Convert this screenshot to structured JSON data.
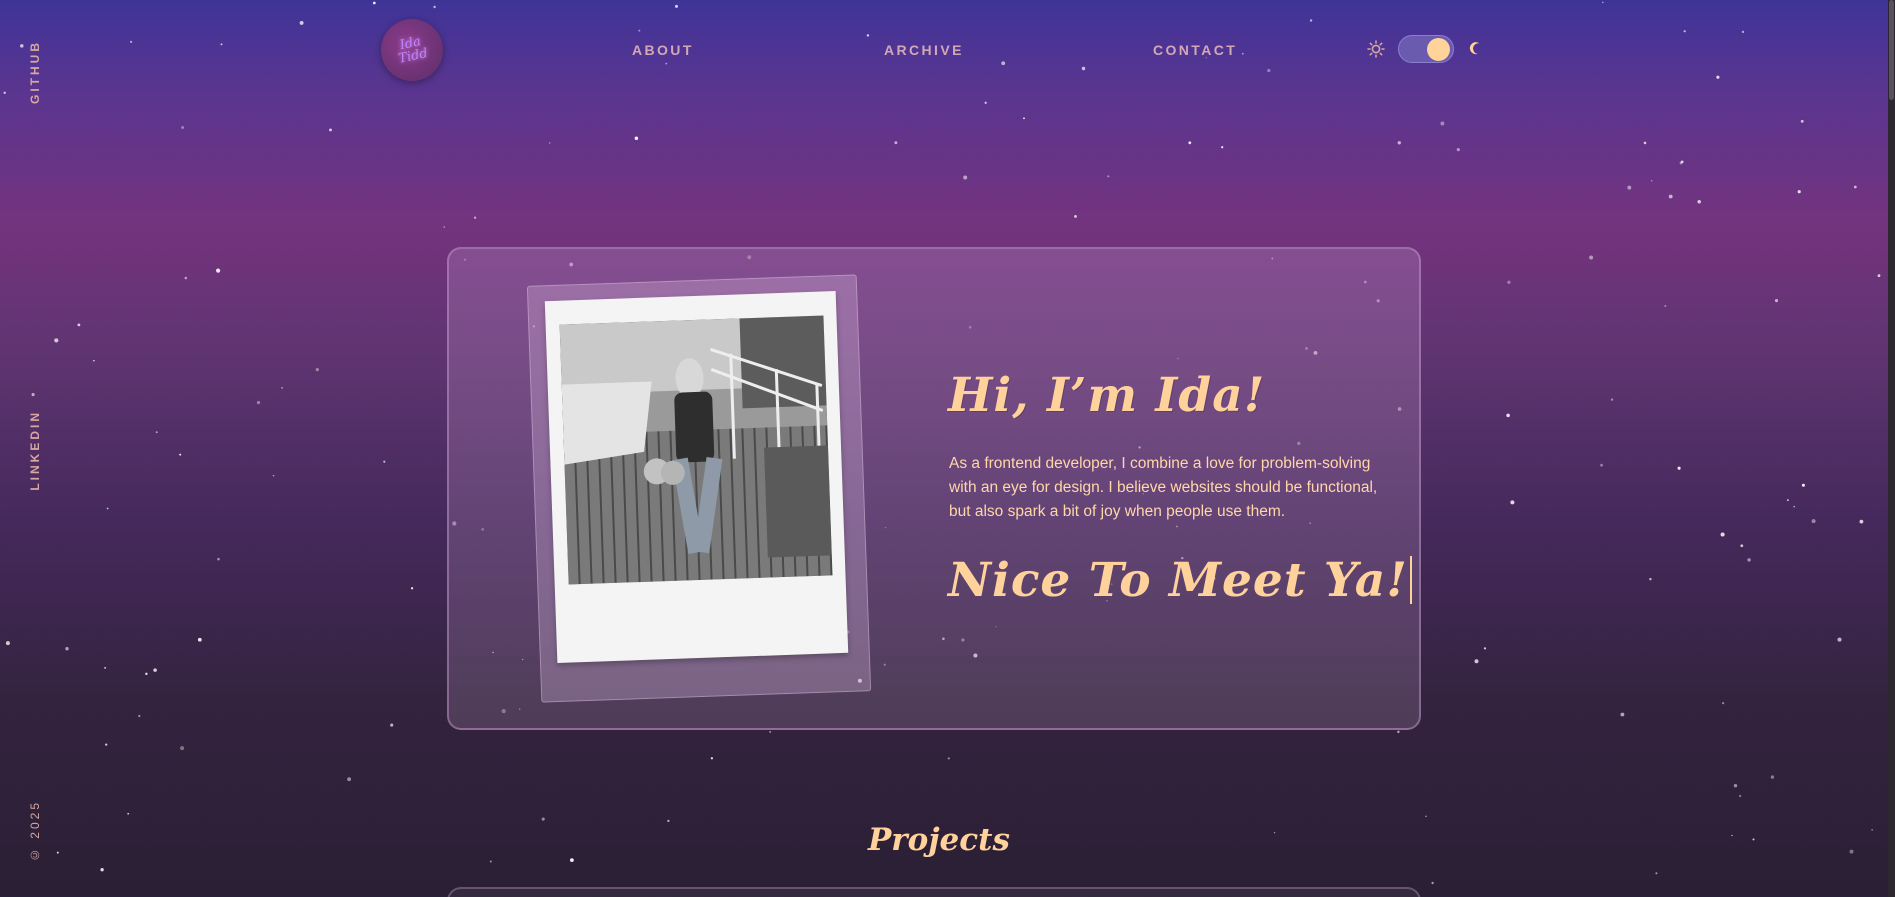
{
  "side_links": {
    "github": "GITHUB",
    "linkedin": "LINKEDIN",
    "copyright": "© 2025"
  },
  "header": {
    "logo_text_line1": "Ida",
    "logo_text_line2": "Tidd",
    "nav": {
      "about": "ABOUT",
      "archive": "ARCHIVE",
      "contact": "CONTACT"
    },
    "theme_toggle": {
      "sun_icon": "sun-icon",
      "moon_icon": "moon-icon",
      "mode": "dark"
    }
  },
  "hero": {
    "title": "Hi, I’m Ida!",
    "bio": "As a frontend developer, I combine a love for problem-solving with an eye for design. I believe websites should be functional, but also spark a bit of joy when people use them.",
    "tagline": "Nice To Meet Ya!"
  },
  "sections": {
    "projects_title": "Projects"
  },
  "colors": {
    "accent": "#ffd29c",
    "text": "#ffd7a8",
    "nav": "#d4a7b6"
  }
}
